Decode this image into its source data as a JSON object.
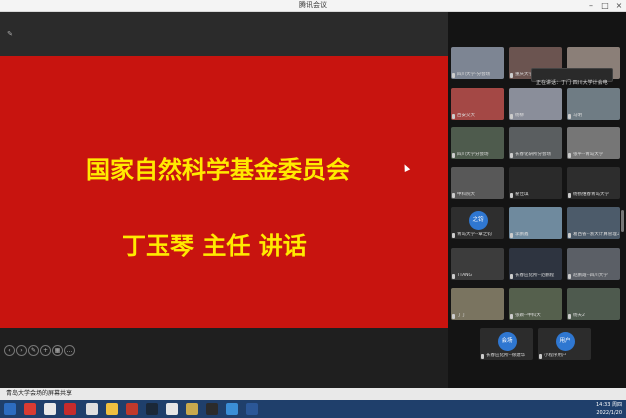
{
  "window": {
    "title": "腾讯会议"
  },
  "slide": {
    "line1": "国家自然科学基金委员会",
    "line2": "丁玉琴  主任  讲话"
  },
  "gallery": {
    "notice": "正在讲话：丁门 四川大学计会电",
    "tiles": [
      {
        "label": "四川大学-分会场",
        "bg": "#7d8593"
      },
      {
        "label": "重庆大学分会场",
        "bg": "#6b5450"
      },
      {
        "label": "",
        "bg": "#8b7f78"
      },
      {
        "label": "西安交大",
        "bg": "#a44845"
      },
      {
        "label": "杨柳",
        "bg": "#8a8e9a"
      },
      {
        "label": "马明",
        "bg": "#6f7c84"
      },
      {
        "label": "四川大学分会场",
        "bg": "#4e5b4d"
      },
      {
        "label": "长春化研所分会场",
        "bg": "#5a5e60"
      },
      {
        "label": "张平--青岛大学",
        "bg": "#767676"
      },
      {
        "label": "中科院大",
        "bg": "#585858"
      },
      {
        "label": "翟佳琪",
        "bg": "#2a2a2a"
      },
      {
        "label": "杨扬维春青岛大学",
        "bg": "#2d2d2d"
      },
      {
        "label": "青岛大学--覃之钧",
        "bg": "#2e2e2e",
        "avatar": "之钧"
      },
      {
        "label": "李鹏鑫",
        "bg": "#6f8a9e"
      },
      {
        "label": "葛西省--浙大计算管理工商院",
        "bg": "#4c5b6a"
      },
      {
        "label": "TTANG",
        "bg": "#3c3c3c"
      },
      {
        "label": "长春应化所--范鹏程",
        "bg": "#2e3440"
      },
      {
        "label": "赵鹏霞--四川大学",
        "bg": "#5b5f66"
      },
      {
        "label": "丁丁",
        "bg": "#7a7460"
      },
      {
        "label": "张颖--中科大",
        "bg": "#55604d"
      },
      {
        "label": "杨天2",
        "bg": "#4e5a4e"
      },
      {
        "label": "长春应化所--徐建华",
        "bg": "#2c2c2c",
        "avatar": "会场"
      },
      {
        "label": "小程序用户",
        "bg": "#2c2c2c",
        "avatar": "用户"
      }
    ]
  },
  "sharebar": {
    "text": "青岛大学会场的屏幕共享"
  },
  "taskbar": {
    "time": "14:33 周四",
    "date": "2022/1/20"
  },
  "colors": {
    "slide_bg": "#c8140f",
    "slide_text": "#ffea00",
    "avatar": "#2f77d1"
  }
}
